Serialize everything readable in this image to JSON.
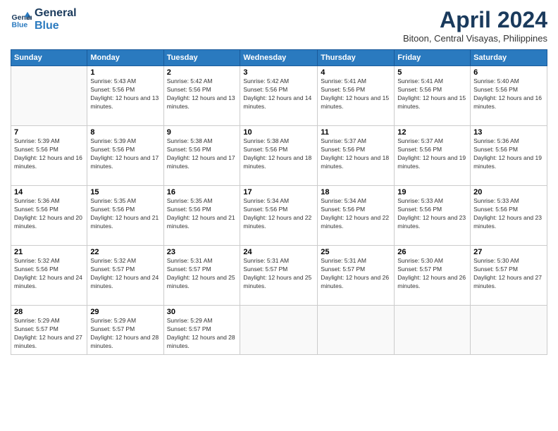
{
  "header": {
    "logo_line1": "General",
    "logo_line2": "Blue",
    "month_title": "April 2024",
    "subtitle": "Bitoon, Central Visayas, Philippines"
  },
  "weekdays": [
    "Sunday",
    "Monday",
    "Tuesday",
    "Wednesday",
    "Thursday",
    "Friday",
    "Saturday"
  ],
  "weeks": [
    [
      {
        "day": "",
        "sunrise": "",
        "sunset": "",
        "daylight": ""
      },
      {
        "day": "1",
        "sunrise": "Sunrise: 5:43 AM",
        "sunset": "Sunset: 5:56 PM",
        "daylight": "Daylight: 12 hours and 13 minutes."
      },
      {
        "day": "2",
        "sunrise": "Sunrise: 5:42 AM",
        "sunset": "Sunset: 5:56 PM",
        "daylight": "Daylight: 12 hours and 13 minutes."
      },
      {
        "day": "3",
        "sunrise": "Sunrise: 5:42 AM",
        "sunset": "Sunset: 5:56 PM",
        "daylight": "Daylight: 12 hours and 14 minutes."
      },
      {
        "day": "4",
        "sunrise": "Sunrise: 5:41 AM",
        "sunset": "Sunset: 5:56 PM",
        "daylight": "Daylight: 12 hours and 15 minutes."
      },
      {
        "day": "5",
        "sunrise": "Sunrise: 5:41 AM",
        "sunset": "Sunset: 5:56 PM",
        "daylight": "Daylight: 12 hours and 15 minutes."
      },
      {
        "day": "6",
        "sunrise": "Sunrise: 5:40 AM",
        "sunset": "Sunset: 5:56 PM",
        "daylight": "Daylight: 12 hours and 16 minutes."
      }
    ],
    [
      {
        "day": "7",
        "sunrise": "Sunrise: 5:39 AM",
        "sunset": "Sunset: 5:56 PM",
        "daylight": "Daylight: 12 hours and 16 minutes."
      },
      {
        "day": "8",
        "sunrise": "Sunrise: 5:39 AM",
        "sunset": "Sunset: 5:56 PM",
        "daylight": "Daylight: 12 hours and 17 minutes."
      },
      {
        "day": "9",
        "sunrise": "Sunrise: 5:38 AM",
        "sunset": "Sunset: 5:56 PM",
        "daylight": "Daylight: 12 hours and 17 minutes."
      },
      {
        "day": "10",
        "sunrise": "Sunrise: 5:38 AM",
        "sunset": "Sunset: 5:56 PM",
        "daylight": "Daylight: 12 hours and 18 minutes."
      },
      {
        "day": "11",
        "sunrise": "Sunrise: 5:37 AM",
        "sunset": "Sunset: 5:56 PM",
        "daylight": "Daylight: 12 hours and 18 minutes."
      },
      {
        "day": "12",
        "sunrise": "Sunrise: 5:37 AM",
        "sunset": "Sunset: 5:56 PM",
        "daylight": "Daylight: 12 hours and 19 minutes."
      },
      {
        "day": "13",
        "sunrise": "Sunrise: 5:36 AM",
        "sunset": "Sunset: 5:56 PM",
        "daylight": "Daylight: 12 hours and 19 minutes."
      }
    ],
    [
      {
        "day": "14",
        "sunrise": "Sunrise: 5:36 AM",
        "sunset": "Sunset: 5:56 PM",
        "daylight": "Daylight: 12 hours and 20 minutes."
      },
      {
        "day": "15",
        "sunrise": "Sunrise: 5:35 AM",
        "sunset": "Sunset: 5:56 PM",
        "daylight": "Daylight: 12 hours and 21 minutes."
      },
      {
        "day": "16",
        "sunrise": "Sunrise: 5:35 AM",
        "sunset": "Sunset: 5:56 PM",
        "daylight": "Daylight: 12 hours and 21 minutes."
      },
      {
        "day": "17",
        "sunrise": "Sunrise: 5:34 AM",
        "sunset": "Sunset: 5:56 PM",
        "daylight": "Daylight: 12 hours and 22 minutes."
      },
      {
        "day": "18",
        "sunrise": "Sunrise: 5:34 AM",
        "sunset": "Sunset: 5:56 PM",
        "daylight": "Daylight: 12 hours and 22 minutes."
      },
      {
        "day": "19",
        "sunrise": "Sunrise: 5:33 AM",
        "sunset": "Sunset: 5:56 PM",
        "daylight": "Daylight: 12 hours and 23 minutes."
      },
      {
        "day": "20",
        "sunrise": "Sunrise: 5:33 AM",
        "sunset": "Sunset: 5:56 PM",
        "daylight": "Daylight: 12 hours and 23 minutes."
      }
    ],
    [
      {
        "day": "21",
        "sunrise": "Sunrise: 5:32 AM",
        "sunset": "Sunset: 5:56 PM",
        "daylight": "Daylight: 12 hours and 24 minutes."
      },
      {
        "day": "22",
        "sunrise": "Sunrise: 5:32 AM",
        "sunset": "Sunset: 5:57 PM",
        "daylight": "Daylight: 12 hours and 24 minutes."
      },
      {
        "day": "23",
        "sunrise": "Sunrise: 5:31 AM",
        "sunset": "Sunset: 5:57 PM",
        "daylight": "Daylight: 12 hours and 25 minutes."
      },
      {
        "day": "24",
        "sunrise": "Sunrise: 5:31 AM",
        "sunset": "Sunset: 5:57 PM",
        "daylight": "Daylight: 12 hours and 25 minutes."
      },
      {
        "day": "25",
        "sunrise": "Sunrise: 5:31 AM",
        "sunset": "Sunset: 5:57 PM",
        "daylight": "Daylight: 12 hours and 26 minutes."
      },
      {
        "day": "26",
        "sunrise": "Sunrise: 5:30 AM",
        "sunset": "Sunset: 5:57 PM",
        "daylight": "Daylight: 12 hours and 26 minutes."
      },
      {
        "day": "27",
        "sunrise": "Sunrise: 5:30 AM",
        "sunset": "Sunset: 5:57 PM",
        "daylight": "Daylight: 12 hours and 27 minutes."
      }
    ],
    [
      {
        "day": "28",
        "sunrise": "Sunrise: 5:29 AM",
        "sunset": "Sunset: 5:57 PM",
        "daylight": "Daylight: 12 hours and 27 minutes."
      },
      {
        "day": "29",
        "sunrise": "Sunrise: 5:29 AM",
        "sunset": "Sunset: 5:57 PM",
        "daylight": "Daylight: 12 hours and 28 minutes."
      },
      {
        "day": "30",
        "sunrise": "Sunrise: 5:29 AM",
        "sunset": "Sunset: 5:57 PM",
        "daylight": "Daylight: 12 hours and 28 minutes."
      },
      {
        "day": "",
        "sunrise": "",
        "sunset": "",
        "daylight": ""
      },
      {
        "day": "",
        "sunrise": "",
        "sunset": "",
        "daylight": ""
      },
      {
        "day": "",
        "sunrise": "",
        "sunset": "",
        "daylight": ""
      },
      {
        "day": "",
        "sunrise": "",
        "sunset": "",
        "daylight": ""
      }
    ]
  ]
}
